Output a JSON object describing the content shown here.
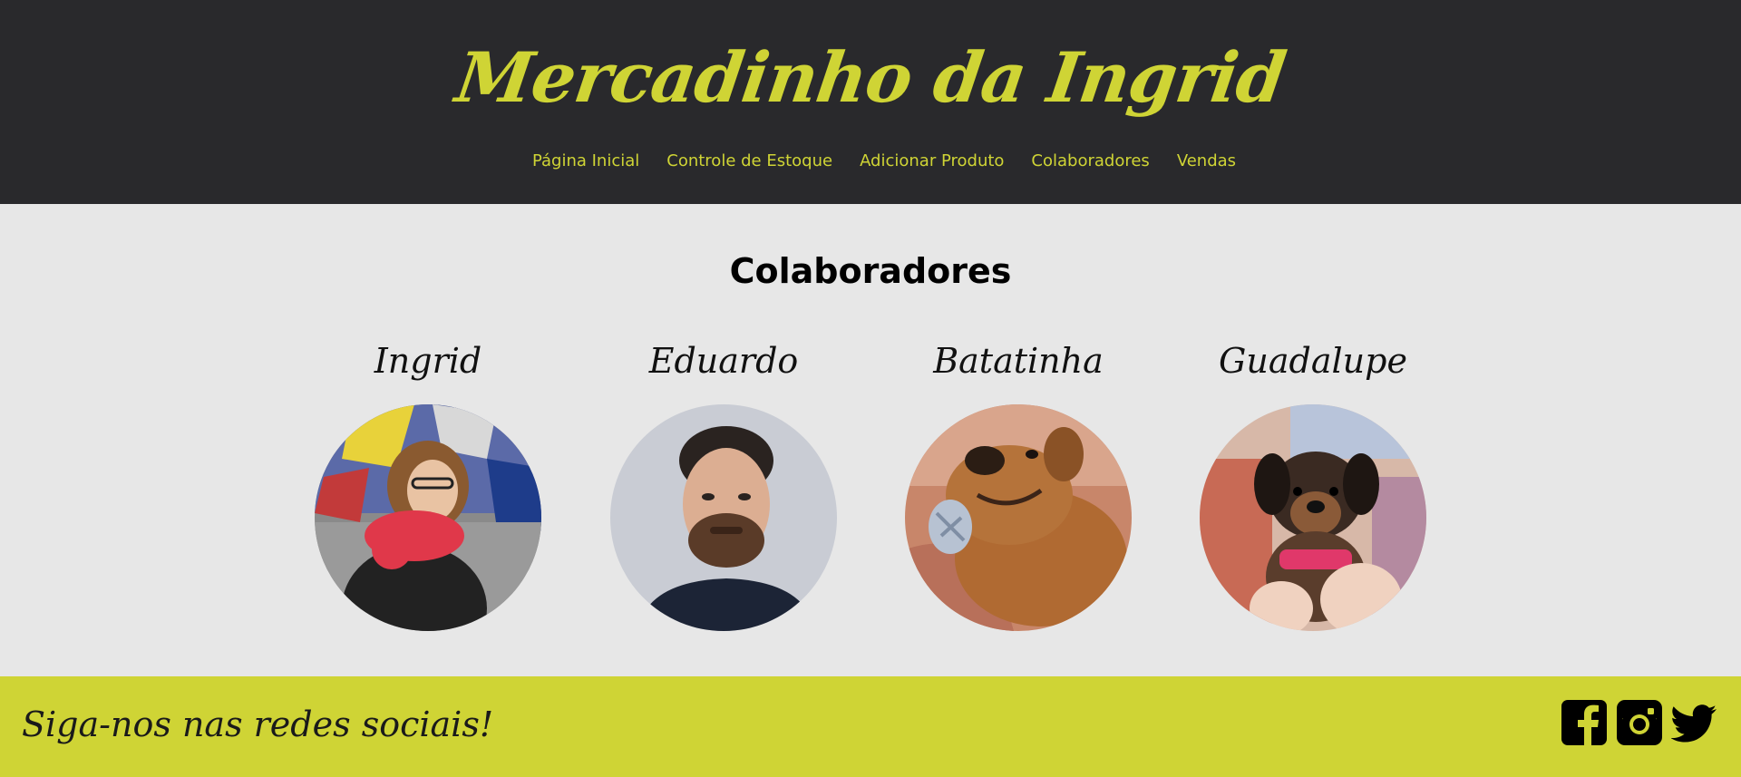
{
  "header": {
    "title": "Mercadinho da Ingrid",
    "nav": [
      "Página Inicial",
      "Controle de Estoque",
      "Adicionar Produto",
      "Colaboradores",
      "Vendas"
    ]
  },
  "main": {
    "title": "Colaboradores",
    "members": [
      {
        "name": "Ingrid"
      },
      {
        "name": "Eduardo"
      },
      {
        "name": "Batatinha"
      },
      {
        "name": "Guadalupe"
      }
    ]
  },
  "footer": {
    "text": "Siga-nos nas redes sociais!",
    "icons": [
      "facebook-icon",
      "instagram-icon",
      "twitter-icon"
    ]
  },
  "colors": {
    "header_bg": "#29292c",
    "accent": "#cfd435",
    "page_bg": "#e7e7e7"
  }
}
